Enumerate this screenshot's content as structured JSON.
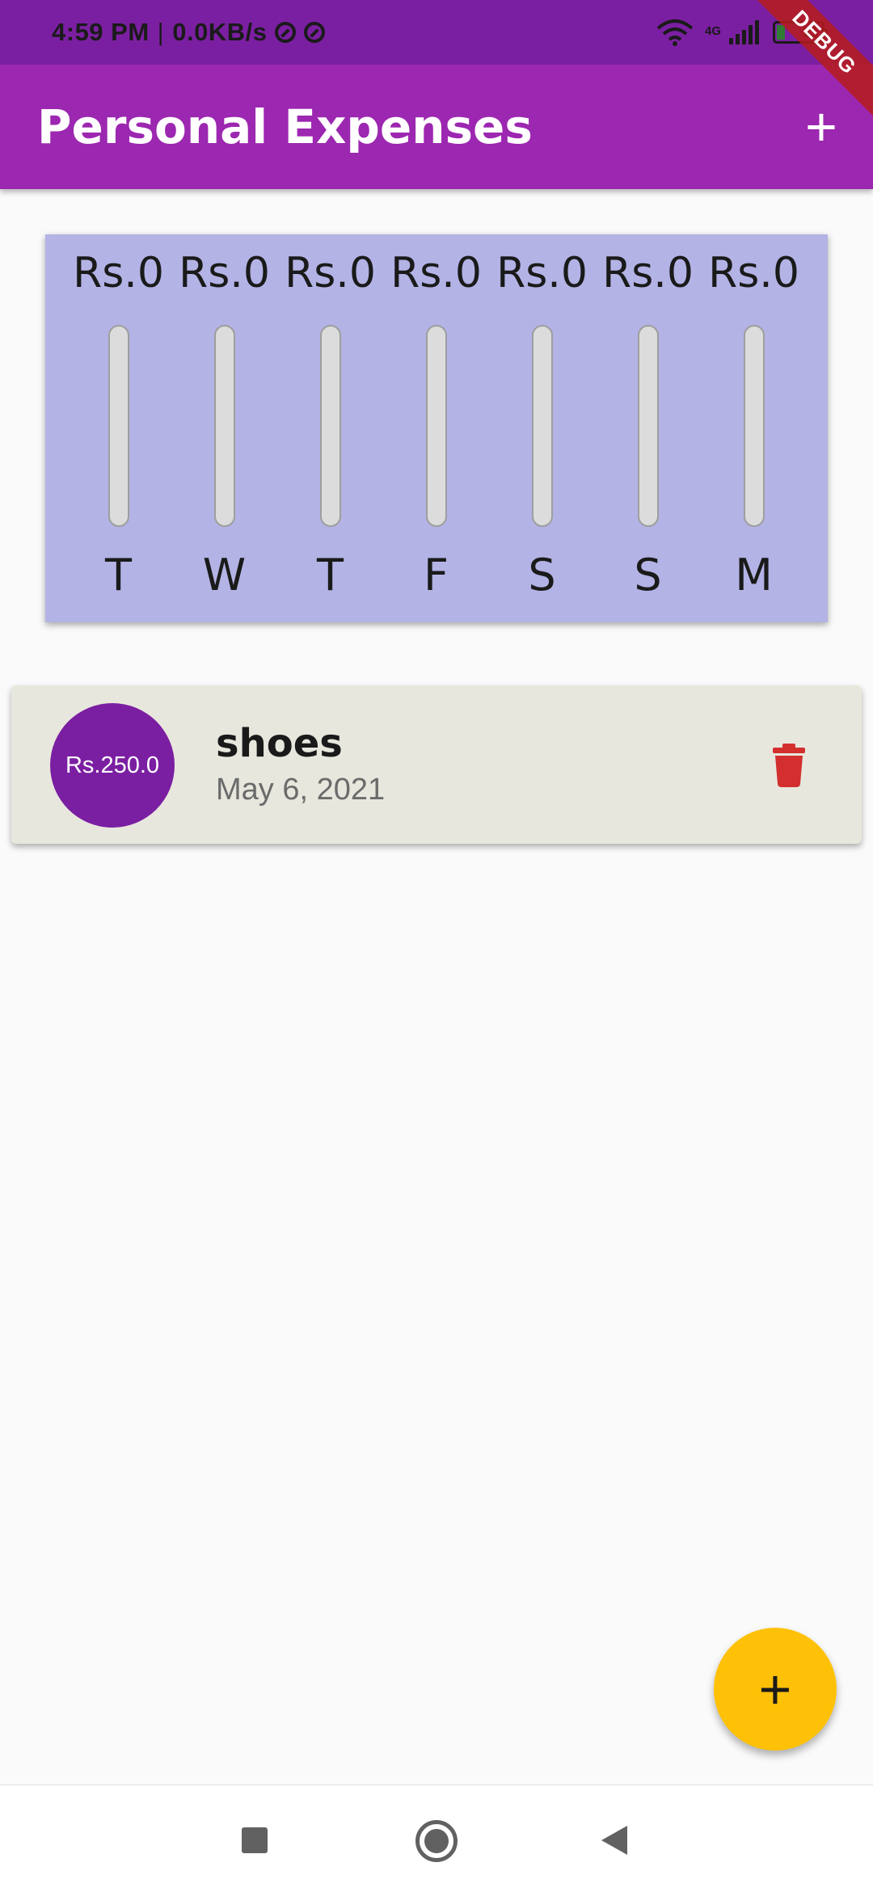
{
  "status_bar": {
    "time": "4:59 PM",
    "separator": "|",
    "speed": "0.0KB/s",
    "network": "4G",
    "battery": "21"
  },
  "app_bar": {
    "title": "Personal Expenses",
    "add_label": "+"
  },
  "debug_banner": "DEBUG",
  "chart": {
    "bars": [
      {
        "amount": "Rs.0",
        "day": "T",
        "fill_fraction": 0
      },
      {
        "amount": "Rs.0",
        "day": "W",
        "fill_fraction": 0
      },
      {
        "amount": "Rs.0",
        "day": "T",
        "fill_fraction": 0
      },
      {
        "amount": "Rs.0",
        "day": "F",
        "fill_fraction": 0
      },
      {
        "amount": "Rs.0",
        "day": "S",
        "fill_fraction": 0
      },
      {
        "amount": "Rs.0",
        "day": "S",
        "fill_fraction": 0
      },
      {
        "amount": "Rs.0",
        "day": "M",
        "fill_fraction": 0
      }
    ]
  },
  "transactions": [
    {
      "amount": "Rs.250.0",
      "title": "shoes",
      "date": "May 6, 2021",
      "delete_icon": "trash-icon"
    }
  ],
  "fab": {
    "label": "+"
  },
  "colors": {
    "status_bar": "#7b1fa2",
    "app_bar": "#9c27b0",
    "chart_card": "#b3b3e6",
    "avatar": "#7b1fa2",
    "delete": "#d32f2f",
    "fab": "#ffc107"
  }
}
